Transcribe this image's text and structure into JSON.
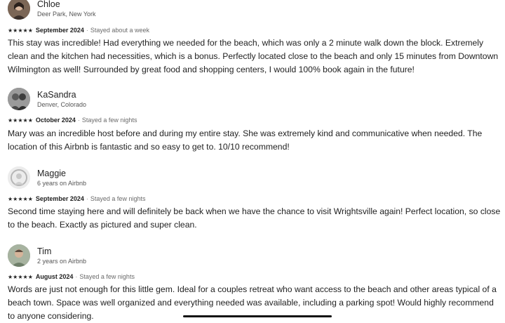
{
  "reviews": [
    {
      "name": "Chloe",
      "subtitle": "Deer Park, New York",
      "stars": "★★★★★",
      "date": "September 2024",
      "stay": "Stayed about a week",
      "text": "This stay was incredible! Had everything we needed for the beach, which was only a 2 minute walk down the block. Extremely clean and the kitchen had necessities, which is a bonus. Perfectly located close to the beach and only 15 minutes from Downtown Wilmington as well! Surrounded by great food and shopping centers, I would 100% book again in the future!"
    },
    {
      "name": "KaSandra",
      "subtitle": "Denver, Colorado",
      "stars": "★★★★★",
      "date": "October 2024",
      "stay": "Stayed a few nights",
      "text": "Mary was an incredible host before and during my entire stay. She was extremely kind and communicative when needed. The location of this Airbnb is fantastic and so easy to get to. 10/10 recommend!"
    },
    {
      "name": "Maggie",
      "subtitle": "6 years on Airbnb",
      "stars": "★★★★★",
      "date": "September 2024",
      "stay": "Stayed a few nights",
      "text": "Second time staying here and will definitely be back when we have the chance to visit Wrightsville again! Perfect location, so close to the beach. Exactly as pictured and super clean."
    },
    {
      "name": "Tim",
      "subtitle": "2 years on Airbnb",
      "stars": "★★★★★",
      "date": "August 2024",
      "stay": "Stayed a few nights",
      "text": "Words are just not enough for this little gem. Ideal for a couples retreat who want access to the beach and other areas typical of a beach town. Space was well organized and everything needed was available, including a parking spot! Would highly recommend to anyone considering."
    }
  ],
  "separator": "·"
}
